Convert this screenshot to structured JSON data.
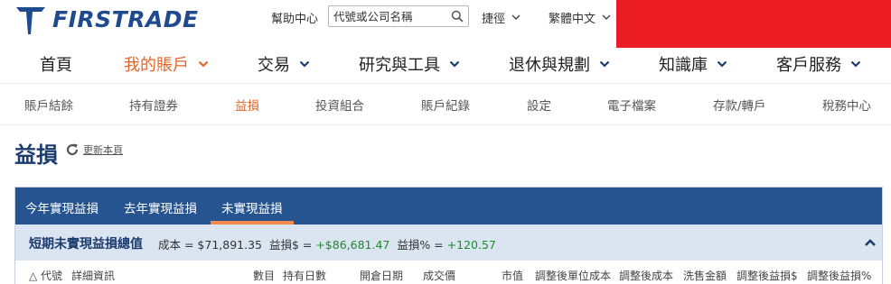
{
  "brand": {
    "name": "FIRSTRADE",
    "color": "#1f4b8e"
  },
  "header": {
    "help_label": "幫助中心",
    "search_placeholder": "代號或公司名稱",
    "shortcut_label": "捷徑",
    "language_label": "繁體中文"
  },
  "nav": {
    "items": [
      {
        "label": "首頁"
      },
      {
        "label": "我的賬戶"
      },
      {
        "label": "交易"
      },
      {
        "label": "研究與工具"
      },
      {
        "label": "退休與規劃"
      },
      {
        "label": "知識庫"
      },
      {
        "label": "客戶服務"
      }
    ],
    "active_color": "#e2662b"
  },
  "subnav": {
    "items": [
      {
        "label": "賬戶結餘"
      },
      {
        "label": "持有證券"
      },
      {
        "label": "益損"
      },
      {
        "label": "投資組合"
      },
      {
        "label": "賬戶紀錄"
      },
      {
        "label": "設定"
      },
      {
        "label": "電子檔案"
      },
      {
        "label": "存款/轉戶"
      },
      {
        "label": "稅務中心"
      }
    ]
  },
  "page": {
    "title": "益損",
    "refresh_label": "更新本頁"
  },
  "panel": {
    "tabs": [
      {
        "label": "今年實現益損"
      },
      {
        "label": "去年實現益損"
      },
      {
        "label": "未實現益損"
      }
    ],
    "summary": {
      "title": "短期未實現益損總值",
      "cost_label": "成本 = $71,891.35",
      "gain_label": "益損$ = ",
      "gain_value": "+$86,681.47",
      "pct_label": "益損% = ",
      "pct_value": "+120.57"
    },
    "columns": [
      "代號",
      "詳細資訊",
      "數目",
      "持有日數",
      "開倉日期",
      "成交價",
      "市值",
      "調整後單位成本",
      "調整後成本",
      "洗售金額",
      "調整後益損$",
      "調整後益損%"
    ]
  },
  "colors": {
    "panel_header": "#265490",
    "summary_bg": "#dbe4f1",
    "positive": "#1e8b2c",
    "tab_underline": "#f58a4b"
  }
}
